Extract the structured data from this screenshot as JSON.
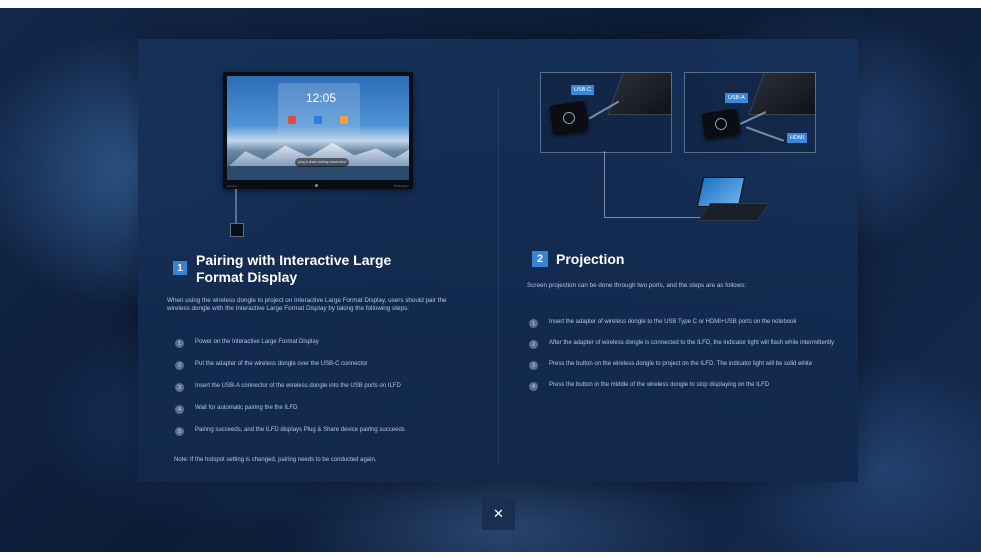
{
  "tv": {
    "clock": "12:05",
    "bar_text": "plug & share pairing succeeded",
    "brand": "Lenovo",
    "model": "ThinkVision"
  },
  "left": {
    "badge": "1",
    "title": "Pairing with Interactive Large Format Display",
    "intro": "When using the wireless dongle to project on Interactive Large Format Display, users should pair the wireless dongle with the Interactive Large Format Display by taking the following steps:",
    "steps": [
      {
        "num": "1",
        "text": "Power on the Interactive Large Format Display"
      },
      {
        "num": "2",
        "text": "Put the adapter of the wireless dongle over the USB-C connector"
      },
      {
        "num": "3",
        "text": "Insert the USB-A connector of the wireless dongle into the USB ports on ILFD"
      },
      {
        "num": "4",
        "text": "Wait for automatic pairing the the ILFD"
      },
      {
        "num": "5",
        "text": "Pairing succeeds, and the ILFD displays Plug & Share device pairing succeeds"
      }
    ],
    "note": "Note: If the hotspot setting is changed, pairing needs to be conducted again."
  },
  "right": {
    "badge": "2",
    "title": "Projection",
    "intro": "Screen projection can be done through two ports, and the steps are as follows:",
    "labels": {
      "usbc": "USB-C",
      "usba": "USB-A",
      "hdmi": "HDMI"
    },
    "steps": [
      {
        "num": "1",
        "text": "Insert the adapter of wireless dongle to the USB Type C or HDMI+USB ports on the notebook"
      },
      {
        "num": "2",
        "text": "After the adapter of wireless dongle is connected to the ILFD, the indicator light will flash while intermittently"
      },
      {
        "num": "3",
        "text": "Press the button on the wireless dongle to project on the ILFD. The indicator light will be solid white"
      },
      {
        "num": "4",
        "text": "Press the button in the middle of the wireless dongle to stop displaying on the ILFD"
      }
    ]
  },
  "close_button": {
    "label": "✕"
  },
  "colors": {
    "accent": "#3a82d2",
    "panel": "#16305a"
  }
}
